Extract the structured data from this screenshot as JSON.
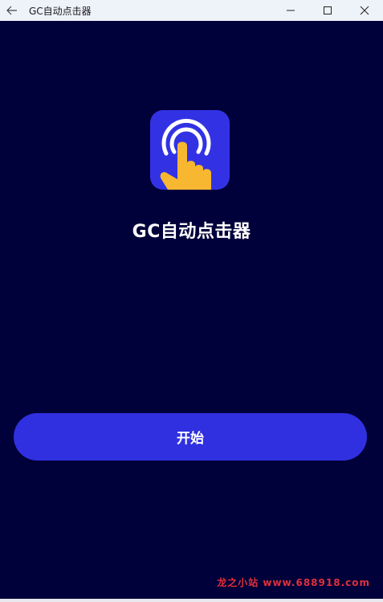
{
  "window": {
    "title": "GC自动点击器",
    "controls": {
      "back_icon": "back-arrow-icon",
      "minimize_icon": "minimize-icon",
      "maximize_icon": "maximize-icon",
      "close_icon": "close-icon"
    }
  },
  "app": {
    "icon": "tap-gesture-icon",
    "title": "GC自动点击器",
    "start_label": "开始"
  },
  "watermark": "龙之小站 www.688918.com",
  "colors": {
    "background": "#00003a",
    "accent": "#3030e0",
    "icon_background": "#3232e4",
    "hand": "#f7b731",
    "watermark": "#e0303a",
    "titlebar": "#eef2f9"
  }
}
